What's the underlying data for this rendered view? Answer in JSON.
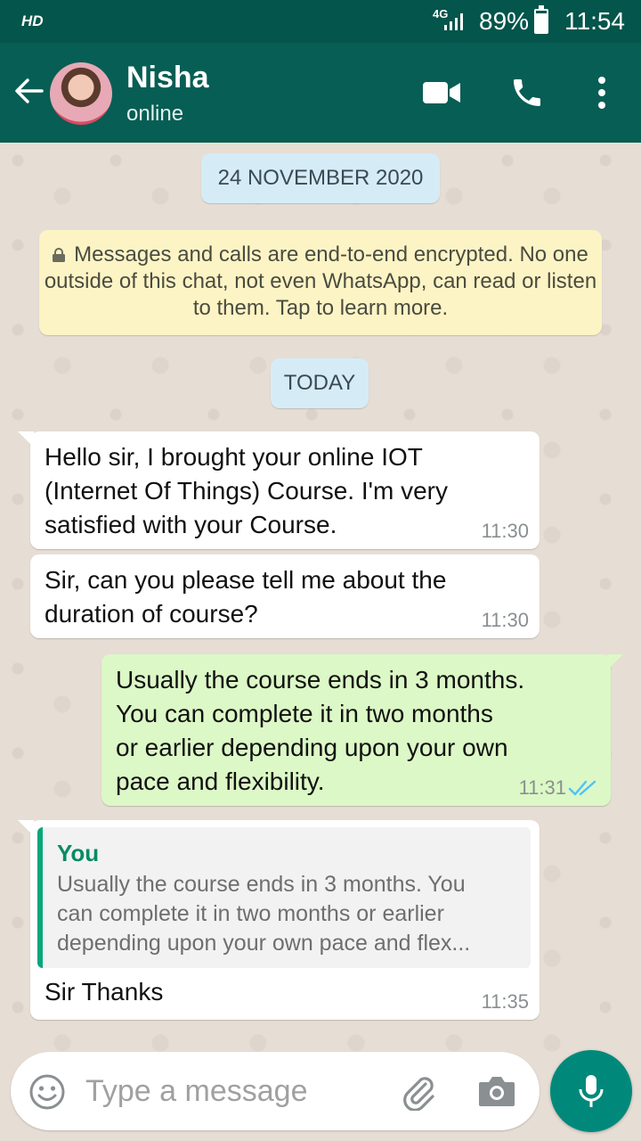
{
  "status_bar": {
    "hd": "HD",
    "network": "4G",
    "battery": "89%",
    "battery_level": 0.89,
    "time": "11:54"
  },
  "header": {
    "contact_name": "Nisha",
    "contact_status": "online"
  },
  "chat": {
    "date_label": "24 NOVEMBER 2020",
    "encryption_notice": "Messages and calls are end-to-end encrypted. No one outside of this chat, not even WhatsApp, can read or listen to them. Tap to learn more.",
    "today_label": "TODAY",
    "messages": [
      {
        "direction": "incoming",
        "lines": [
          "Hello sir, I brought your online IOT",
          "(Internet Of Things) Course. I'm very",
          "satisfied with your Course."
        ],
        "time": "11:30"
      },
      {
        "direction": "incoming",
        "lines": [
          "Sir, can you please tell me about the",
          "duration of course?"
        ],
        "time": "11:30"
      },
      {
        "direction": "outgoing",
        "lines": [
          "Usually the course ends in 3 months.",
          "You can complete it in two months",
          "or earlier depending upon your own",
          "pace and flexibility."
        ],
        "time": "11:31",
        "read": true
      },
      {
        "direction": "incoming",
        "quote_author": "You",
        "quote_lines": [
          "Usually the course ends in 3 months. You",
          "can complete it in two months or earlier",
          "depending upon your own pace and flex..."
        ],
        "lines": [
          "Sir Thanks"
        ],
        "time": "11:35"
      }
    ]
  },
  "composer": {
    "placeholder": "Type a message"
  },
  "colors": {
    "header": "#075e54",
    "status_bar": "#04554b",
    "outgoing_bubble": "#dcf8c6",
    "accent": "#00897b",
    "read_ticks": "#4fc3f7"
  },
  "icons": [
    "back-arrow-icon",
    "video-call-icon",
    "phone-icon",
    "more-options-icon",
    "lock-icon",
    "double-check-icon",
    "emoji-icon",
    "attach-icon",
    "camera-icon",
    "mic-icon"
  ]
}
